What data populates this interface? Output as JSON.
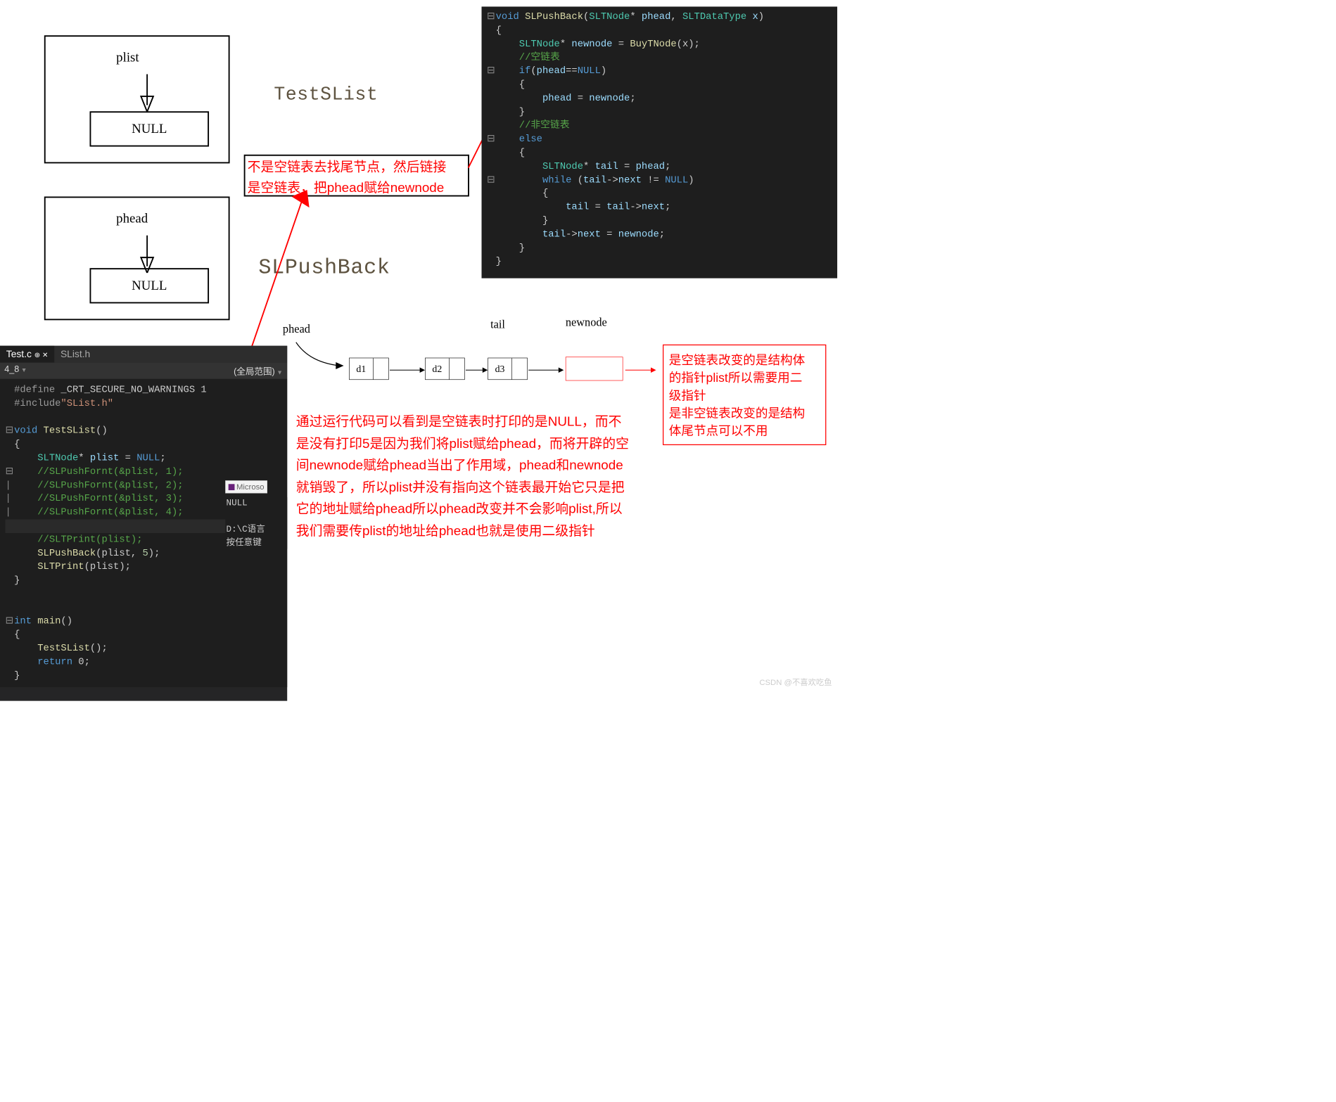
{
  "diagrams": {
    "plist_label": "plist",
    "phead_label": "phead",
    "null_text": "NULL"
  },
  "titles": {
    "test": "TestSList",
    "push": "SLPushBack"
  },
  "annotations": {
    "red1_line1": "不是空链表去找尾节点，然后链接",
    "red1_line2": "是空链表，把phead赋给newnode",
    "paragraph": "通过运行代码可以看到是空链表时打印的是NULL，而不是没有打印5是因为我们将plist赋给phead，而将开辟的空间newnode赋给phead当出了作用域，phead和newnode就销毁了，所以plist并没有指向这个链表最开始它只是把它的地址赋给phead所以phead改变并不会影响plist,所以我们需要传plist的地址给phead也就是使用二级指针",
    "side_box_line1": "是空链表改变的是结构体",
    "side_box_line2": "的指针plist所以需要用二",
    "side_box_line3": "级指针",
    "side_box_line4": "是非空链表改变的是结构",
    "side_box_line5": "体尾节点可以不用"
  },
  "linked_list": {
    "phead_label": "phead",
    "tail_label": "tail",
    "newnode_label": "newnode",
    "nodes": [
      "d1",
      "d2",
      "d3"
    ]
  },
  "top_code": {
    "sig": "void SLPushBack(SLTNode* phead, SLTDataType x)",
    "l1": "{",
    "l2_a": "SLTNode* newnode = ",
    "l2_b": "BuyTNode",
    "l2_c": "(x);",
    "l3": "//空链表",
    "l4": "if(phead==NULL)",
    "l5": "{",
    "l6": "phead = newnode;",
    "l7": "}",
    "l8": "//非空链表",
    "l9": "else",
    "l10": "{",
    "l11": "SLTNode* tail = phead;",
    "l12": "while (tail->next != NULL)",
    "l13": "{",
    "l14": "tail = tail->next;",
    "l15": "}",
    "l16": "tail->next = newnode;",
    "l17": "}",
    "l18": "}"
  },
  "bottom_editor": {
    "project_label": "4_8",
    "tab1": "Test.c",
    "tab2": "SList.h",
    "scope_left": "",
    "scope_right": "(全局范围)",
    "line1a": "#define",
    "line1b": " _CRT_SECURE_NO_WARNINGS 1",
    "line2a": "#include",
    "line2b": "\"SList.h\"",
    "line3": "void TestSList()",
    "line4": "{",
    "line5a": "SLTNode* plist = ",
    "line5b": "NULL",
    "line5c": ";",
    "line6": "//SLPushFornt(&plist, 1);",
    "line7": "//SLPushFornt(&plist, 2);",
    "line8": "//SLPushFornt(&plist, 3);",
    "line9": "//SLPushFornt(&plist, 4);",
    "line10": "//SLTPrint(plist);",
    "line11a": "SLPushBack",
    "line11b": "(plist, ",
    "line11c": "5",
    "line11d": ");",
    "line12a": "SLTPrint",
    "line12b": "(plist);",
    "line13": "}",
    "line14": "int main()",
    "line15": "{",
    "line16a": "TestSList",
    "line16b": "();",
    "line17a": "return",
    "line17b": " 0;",
    "line18": "}"
  },
  "console": {
    "badge": "Microso",
    "out1": "NULL",
    "out2": "D:\\C语言",
    "out3": "按任意键"
  },
  "watermark": "CSDN @不喜欢吃鱼"
}
